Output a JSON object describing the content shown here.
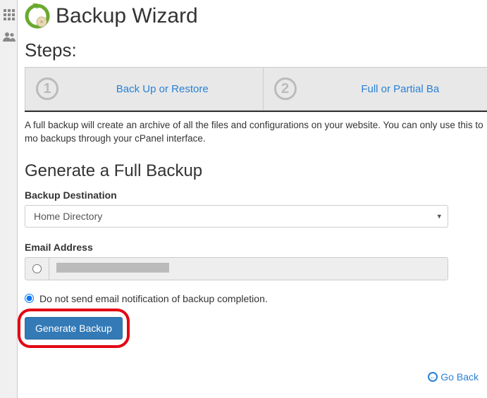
{
  "page": {
    "title": "Backup Wizard"
  },
  "steps": {
    "heading": "Steps:",
    "items": [
      {
        "num": "1",
        "label": "Back Up or Restore"
      },
      {
        "num": "2",
        "label": "Full or Partial Ba"
      }
    ]
  },
  "description": "A full backup will create an archive of all the files and configurations on your website. You can only use this to mo backups through your cPanel interface.",
  "generate": {
    "heading": "Generate a Full Backup",
    "destination_label": "Backup Destination",
    "destination_value": "Home Directory",
    "email_label": "Email Address",
    "no_email_label": "Do not send email notification of backup completion.",
    "button_label": "Generate Backup"
  },
  "goback_label": "Go Back"
}
